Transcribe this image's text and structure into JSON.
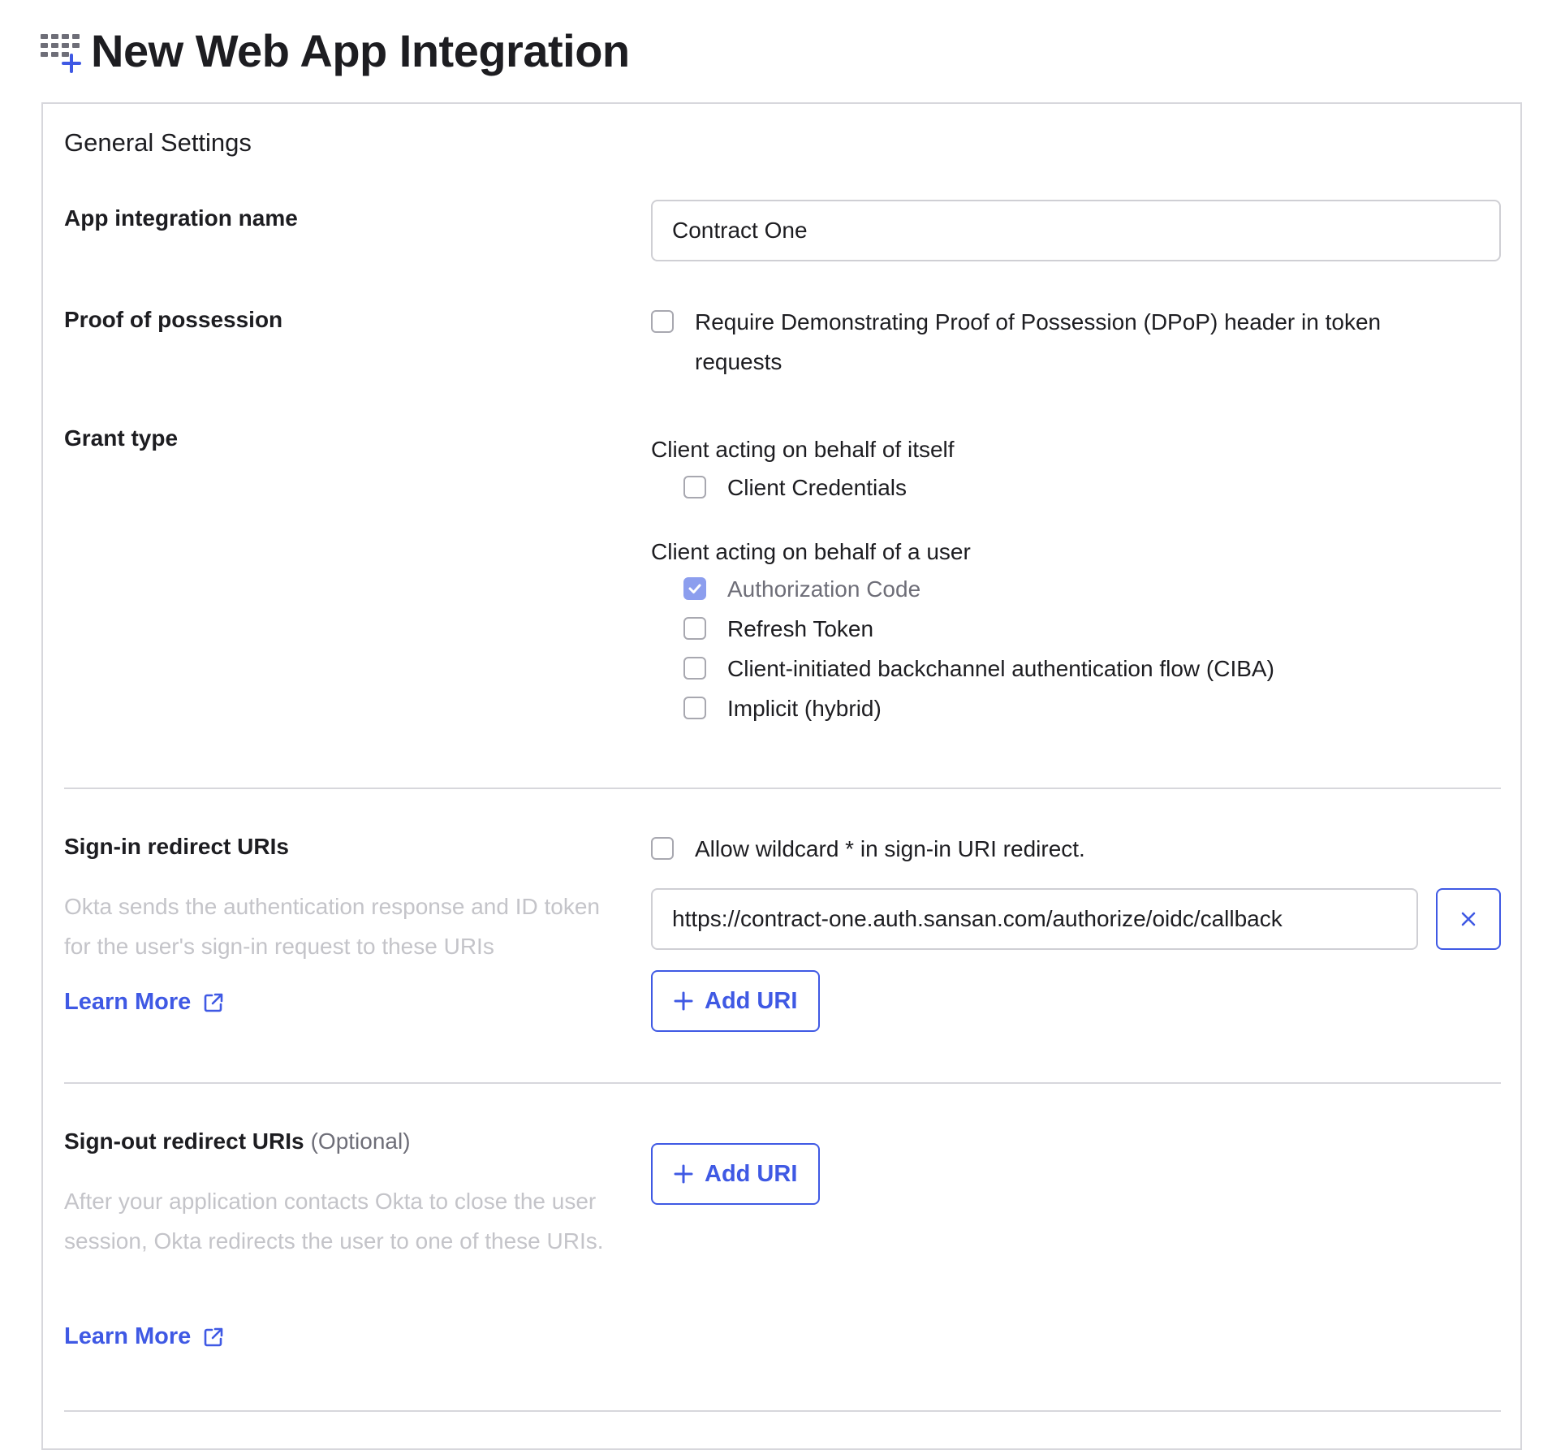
{
  "page": {
    "title": "New Web App Integration",
    "icon": "app-grid-add-icon"
  },
  "colors": {
    "accent": "#3f59e4",
    "checked": "#8c9eee",
    "muted_text": "#c4c4c9",
    "border": "#d7d7dc"
  },
  "general_settings": {
    "title": "General Settings",
    "app_name": {
      "label": "App integration name",
      "value": "Contract One"
    },
    "proof_of_possession": {
      "label": "Proof of possession",
      "option": {
        "label": "Require Demonstrating Proof of Possession (DPoP) header in token requests",
        "checked": false
      }
    },
    "grant_type": {
      "label": "Grant type",
      "groups": [
        {
          "heading": "Client acting on behalf of itself",
          "options": [
            {
              "label": "Client Credentials",
              "checked": false
            }
          ]
        },
        {
          "heading": "Client acting on behalf of a user",
          "options": [
            {
              "label": "Authorization Code",
              "checked": true,
              "disabled": true
            },
            {
              "label": "Refresh Token",
              "checked": false
            },
            {
              "label": "Client-initiated backchannel authentication flow (CIBA)",
              "checked": false
            },
            {
              "label": "Implicit (hybrid)",
              "checked": false
            }
          ]
        }
      ]
    },
    "sign_in_redirect": {
      "label": "Sign-in redirect URIs",
      "description": "Okta sends the authentication response and ID token for the user's sign-in request to these URIs",
      "learn_more": "Learn More",
      "wildcard_option": {
        "label": "Allow wildcard * in sign-in URI redirect.",
        "checked": false
      },
      "uris": [
        "https://contract-one.auth.sansan.com/authorize/oidc/callback"
      ],
      "add_label": "Add URI"
    },
    "sign_out_redirect": {
      "label": "Sign-out redirect URIs",
      "optional": "(Optional)",
      "description": "After your application contacts Okta to close the user session, Okta redirects the user to one of these URIs.",
      "learn_more": "Learn More",
      "add_label": "Add URI"
    }
  }
}
